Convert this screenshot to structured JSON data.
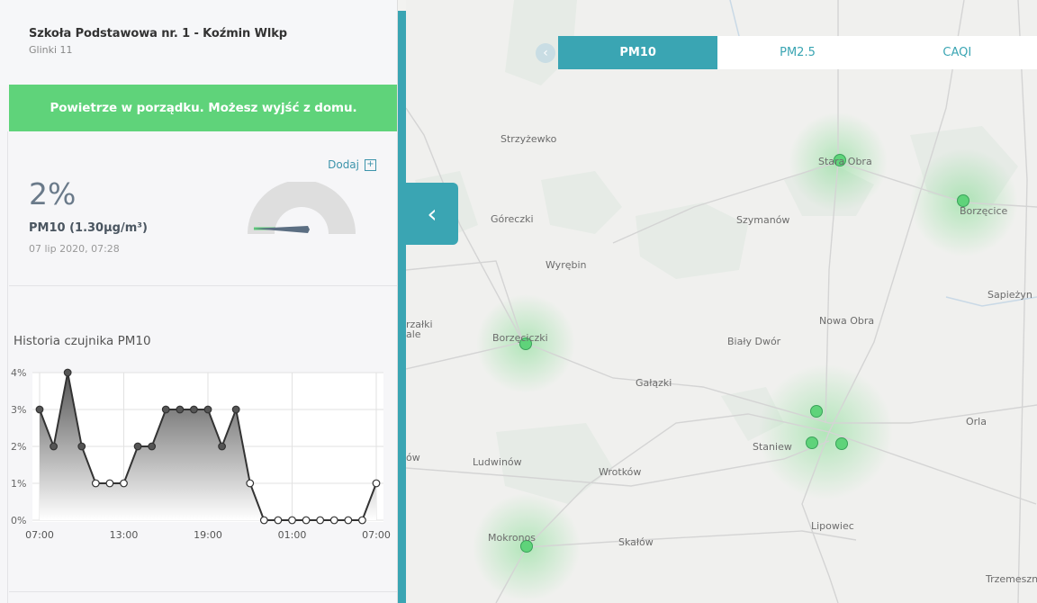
{
  "station": {
    "name": "Szkoła Podstawowa nr. 1 - Koźmin Wlkp",
    "address": "Glinki 11"
  },
  "status": {
    "message": "Powietrze w porządku. Możesz wyjść z domu.",
    "color": "#5fd37a"
  },
  "reading": {
    "add_label": "Dodaj",
    "add_icon": "plus-square-icon",
    "percent": "2%",
    "pm_label": "PM10 (1.30µg/m³)",
    "timestamp": "07 lip 2020, 07:28",
    "gauge_level_percent": 2
  },
  "history": {
    "title": "Historia czujnika PM10"
  },
  "chart_data": {
    "type": "area",
    "x_ticks": [
      "07:00",
      "13:00",
      "19:00",
      "01:00",
      "07:00"
    ],
    "y_ticks": [
      "0%",
      "1%",
      "2%",
      "3%",
      "4%"
    ],
    "ylim": [
      0,
      4
    ],
    "grid": true,
    "series": [
      {
        "values": [
          3,
          2,
          4,
          2,
          1,
          1,
          1,
          2,
          2,
          3,
          3,
          3,
          3,
          2,
          3,
          1,
          0,
          0,
          0,
          0,
          0,
          0,
          0,
          0,
          1
        ]
      }
    ]
  },
  "tabs": [
    {
      "label": "PM10",
      "active": true
    },
    {
      "label": "PM2.5",
      "active": false
    },
    {
      "label": "CAQI",
      "active": false
    }
  ],
  "map": {
    "places": [
      "Strzyżewko",
      "Stara Obra",
      "Borzęcice",
      "Góreczki",
      "Szymanów",
      "Wyrębin",
      "Sapieżyn",
      "Nowa Obra",
      "rzałki",
      "ale",
      "Borzęciczki",
      "Biały Dwór",
      "Gałązki",
      "Orla",
      "Staniew",
      "ów",
      "Ludwinów",
      "Wrotków",
      "Lipowiec",
      "Mokronos",
      "Skałów",
      "Trzemeszn"
    ]
  },
  "colors": {
    "accent": "#3aa5b3",
    "sensor_good": "#5fd37a"
  }
}
